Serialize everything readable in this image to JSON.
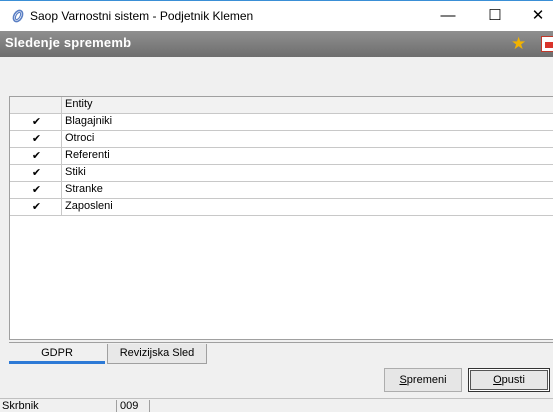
{
  "window": {
    "title": "Saop Varnostni sistem - Podjetnik Klemen",
    "minimize": "—",
    "maximize": "☐",
    "close": "✕"
  },
  "header": {
    "title": "Sledenje sprememb",
    "favorite_icon": "star-icon",
    "report_icon": "pdf-report-icon"
  },
  "grid": {
    "column_header": "Entity",
    "rows": [
      {
        "checked": true,
        "entity": "Blagajniki"
      },
      {
        "checked": true,
        "entity": "Otroci"
      },
      {
        "checked": true,
        "entity": "Referenti"
      },
      {
        "checked": true,
        "entity": "Stiki"
      },
      {
        "checked": true,
        "entity": "Stranke"
      },
      {
        "checked": true,
        "entity": "Zaposleni"
      }
    ]
  },
  "tabs": [
    {
      "label": "GDPR",
      "active": true
    },
    {
      "label": "Revizijska Sled",
      "active": false
    }
  ],
  "buttons": {
    "spremeni_accel": "S",
    "spremeni_rest": "premeni",
    "opusti_accel": "O",
    "opusti_rest": "pusti"
  },
  "status": {
    "user": "Skrbnik",
    "code": "009"
  },
  "colors": {
    "accent_tab": "#2d7ad6",
    "header_bg": "#7f7f7f"
  }
}
